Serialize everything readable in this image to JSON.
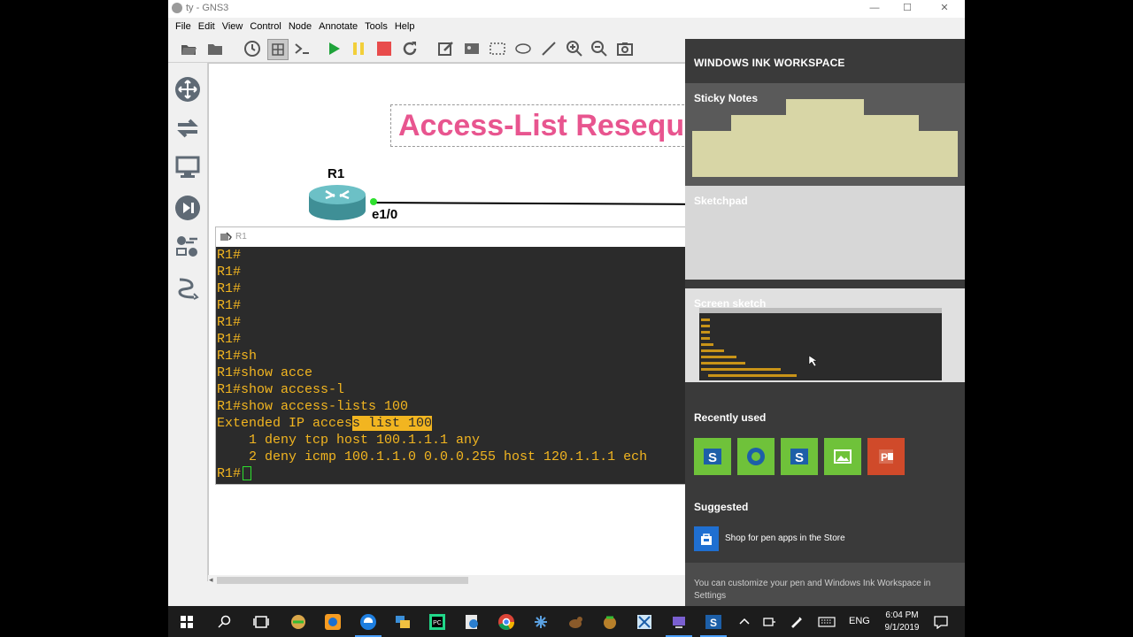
{
  "window": {
    "title": "ty - GNS3",
    "minimize": "—",
    "maximize": "☐",
    "close": "✕"
  },
  "menu": [
    "File",
    "Edit",
    "View",
    "Control",
    "Node",
    "Annotate",
    "Tools",
    "Help"
  ],
  "toolbar": {
    "icons": [
      "open-folder-icon",
      "folder-icon",
      "clock-icon",
      "grid-icon",
      "console-icon",
      "play-icon",
      "pause-icon",
      "stop-icon",
      "reload-icon",
      "edit-note-icon",
      "image-icon",
      "rectangle-icon",
      "ellipse-icon",
      "line-icon",
      "zoom-in-icon",
      "zoom-out-icon",
      "camera-icon"
    ],
    "colors": {
      "play": "#1fa33a",
      "pause": "#f2cf3a",
      "stop": "#e84c4c"
    }
  },
  "devicebar": {
    "icons": [
      "routers-icon",
      "switches-icon",
      "end-devices-icon",
      "security-devices-icon",
      "all-devices-icon",
      "add-link-icon"
    ]
  },
  "canvas": {
    "note": "Access-List Reseque",
    "note_color": "#e8558f",
    "node_label": "R1",
    "port_label": "e1/0"
  },
  "console": {
    "title": "R1",
    "lines": [
      "R1#",
      "R1#",
      "R1#",
      "R1#",
      "R1#",
      "R1#",
      "R1#sh",
      "R1#show acce",
      "R1#show access-l",
      "R1#show access-lists 100"
    ],
    "extended_prefix": "Extended IP acces",
    "extended_highlight": "s list 100",
    "acl_lines": [
      "    1 deny tcp host 100.1.1.1 any",
      "    2 deny icmp 100.1.1.0 0.0.0.255 host 120.1.1.1 ech"
    ],
    "prompt": "R1#",
    "text_color": "#f2b520",
    "background": "#2b2b2b"
  },
  "ink_workspace": {
    "header": "WINDOWS INK WORKSPACE",
    "sticky_notes": "Sticky Notes",
    "sketchpad": "Sketchpad",
    "screen_sketch": "Screen sketch",
    "recently_used": "Recently used",
    "recent_apps": [
      {
        "icon": "snagit-icon",
        "color": "#6fc23a",
        "glyph": "S"
      },
      {
        "icon": "edge-icon",
        "color": "#6fc23a",
        "glyph": "e"
      },
      {
        "icon": "snagit-icon",
        "color": "#6fc23a",
        "glyph": "S"
      },
      {
        "icon": "photos-icon",
        "color": "#6fc23a",
        "glyph": "▲"
      },
      {
        "icon": "powerpoint-icon",
        "color": "#d04a2a",
        "glyph": "P"
      }
    ],
    "suggested": "Suggested",
    "store_item": "Shop for pen apps in the Store",
    "footer": "You can customize your pen and Windows Ink Workspace in Settings"
  },
  "taskbar": {
    "icons": [
      "start-icon",
      "search-icon",
      "task-view-icon",
      "app-icon-1",
      "app-icon-2",
      "edge-icon",
      "file-explorer-icon",
      "pycharm-icon",
      "app-icon-3",
      "chrome-icon",
      "app-icon-4",
      "app-icon-5",
      "app-icon-6",
      "snipping-icon",
      "app-icon-7",
      "snagit-icon"
    ],
    "tray_icons": [
      "chevron-up-icon",
      "network-icon",
      "pen-icon",
      "keyboard-icon"
    ],
    "language": "ENG",
    "time": "6:04 PM",
    "date": "9/1/2019",
    "notification_icon": "notification-icon"
  }
}
